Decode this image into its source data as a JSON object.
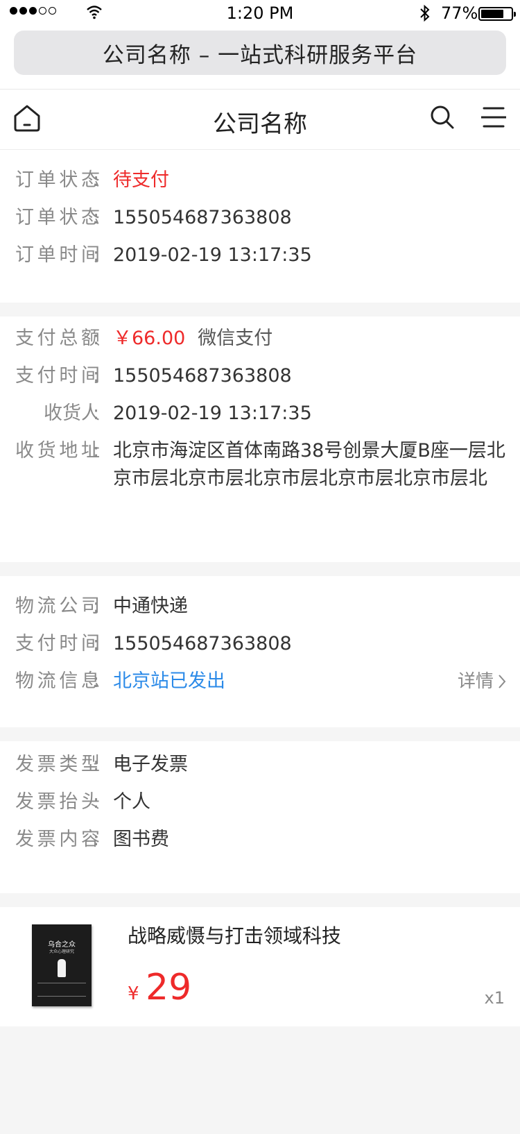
{
  "status_bar": {
    "signal_dots_filled": 3,
    "signal_dots_total": 5,
    "time": "1:20 PM",
    "battery_percent": "77%",
    "battery_level": 0.77
  },
  "browser": {
    "url_title": "公司名称 – 一站式科研服务平台"
  },
  "header": {
    "title": "公司名称"
  },
  "order": {
    "status_label": "订单状态",
    "status_value": "待支付",
    "number_label": "订单状态",
    "number_value": "155054687363808",
    "time_label": "订单时间",
    "time_value": "2019-02-19 13:17:35"
  },
  "payment": {
    "total_label": "支付总额",
    "total_value": "￥66.00",
    "method": "微信支付",
    "time_label": "支付时间",
    "time_value": "155054687363808",
    "receiver_label": "收货人",
    "receiver_value": "2019-02-19 13:17:35",
    "address_label": "收货地址",
    "address_value": "北京市海淀区首体南路38号创景大厦B座一层北京市层北京市层北京市层北京市层北京市层北"
  },
  "logistics": {
    "company_label": "物流公司",
    "company_value": "中通快递",
    "time_label": "支付时间",
    "time_value": "155054687363808",
    "info_label": "物流信息",
    "info_value": "北京站已发出",
    "detail_label": "详情"
  },
  "invoice": {
    "type_label": "发票类型",
    "type_value": "电子发票",
    "header_label": "发票抬头",
    "header_value": "个人",
    "content_label": "发票内容",
    "content_value": "图书费"
  },
  "product": {
    "cover_title": "乌合之众",
    "cover_subtitle": "大众心理研究",
    "name": "战略威慑与打击领域科技",
    "currency": "¥",
    "price": "29",
    "quantity": "x1"
  },
  "colors": {
    "accent_red": "#ee2a2a",
    "link_blue": "#2b8ae8",
    "label_gray": "#8a8a8a",
    "page_bg": "#f5f5f5"
  }
}
